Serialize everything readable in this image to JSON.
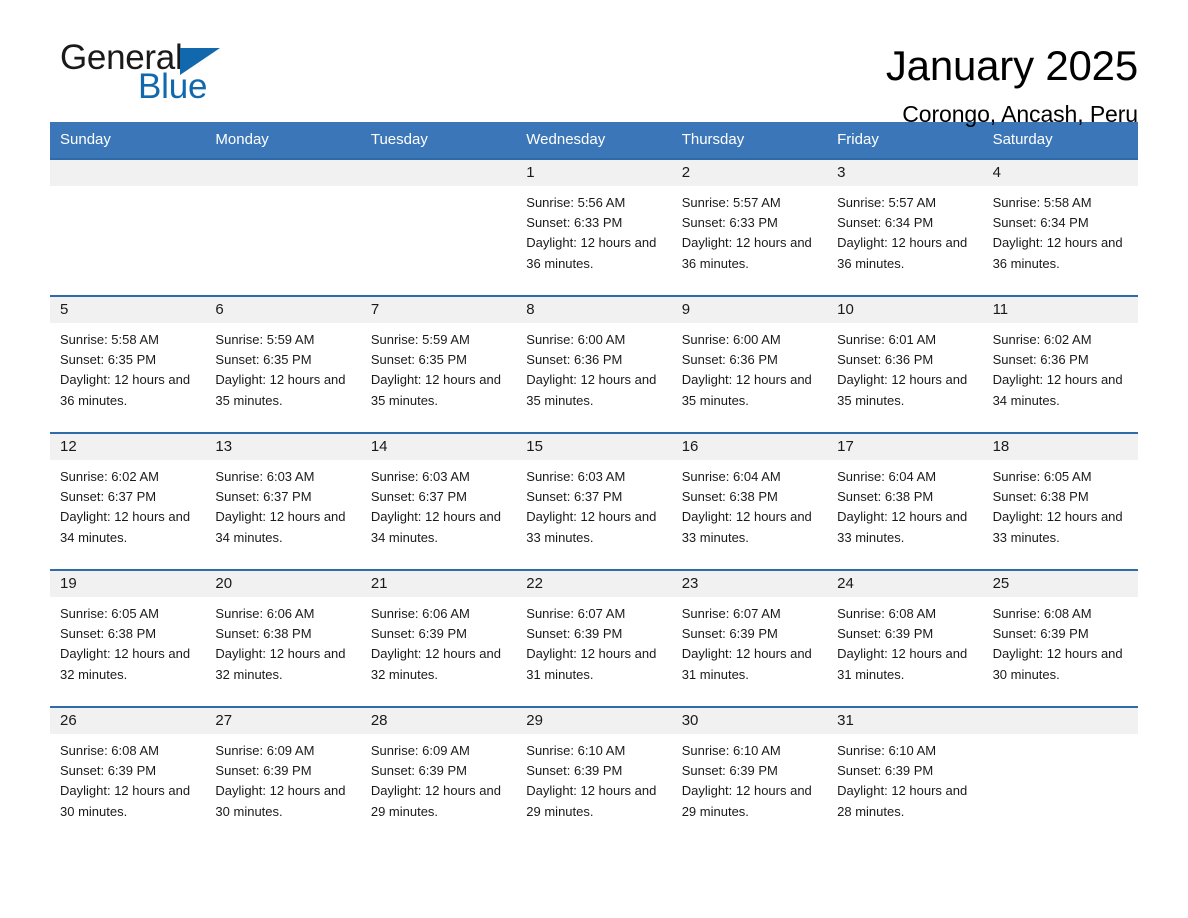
{
  "logo": {
    "word1": "General",
    "word2": "Blue",
    "triangle_color": "#1168ad"
  },
  "header": {
    "month_title": "January 2025",
    "location": "Corongo, Ancash, Peru"
  },
  "calendar": {
    "header_bg": "#3a76b8",
    "row_border": "#2d6ca8",
    "daynum_bg": "#f1f1f1",
    "weekdays": [
      "Sunday",
      "Monday",
      "Tuesday",
      "Wednesday",
      "Thursday",
      "Friday",
      "Saturday"
    ],
    "weeks": [
      [
        {
          "day": ""
        },
        {
          "day": ""
        },
        {
          "day": ""
        },
        {
          "day": "1",
          "sunrise": "Sunrise: 5:56 AM",
          "sunset": "Sunset: 6:33 PM",
          "daylight": "Daylight: 12 hours and 36 minutes."
        },
        {
          "day": "2",
          "sunrise": "Sunrise: 5:57 AM",
          "sunset": "Sunset: 6:33 PM",
          "daylight": "Daylight: 12 hours and 36 minutes."
        },
        {
          "day": "3",
          "sunrise": "Sunrise: 5:57 AM",
          "sunset": "Sunset: 6:34 PM",
          "daylight": "Daylight: 12 hours and 36 minutes."
        },
        {
          "day": "4",
          "sunrise": "Sunrise: 5:58 AM",
          "sunset": "Sunset: 6:34 PM",
          "daylight": "Daylight: 12 hours and 36 minutes."
        }
      ],
      [
        {
          "day": "5",
          "sunrise": "Sunrise: 5:58 AM",
          "sunset": "Sunset: 6:35 PM",
          "daylight": "Daylight: 12 hours and 36 minutes."
        },
        {
          "day": "6",
          "sunrise": "Sunrise: 5:59 AM",
          "sunset": "Sunset: 6:35 PM",
          "daylight": "Daylight: 12 hours and 35 minutes."
        },
        {
          "day": "7",
          "sunrise": "Sunrise: 5:59 AM",
          "sunset": "Sunset: 6:35 PM",
          "daylight": "Daylight: 12 hours and 35 minutes."
        },
        {
          "day": "8",
          "sunrise": "Sunrise: 6:00 AM",
          "sunset": "Sunset: 6:36 PM",
          "daylight": "Daylight: 12 hours and 35 minutes."
        },
        {
          "day": "9",
          "sunrise": "Sunrise: 6:00 AM",
          "sunset": "Sunset: 6:36 PM",
          "daylight": "Daylight: 12 hours and 35 minutes."
        },
        {
          "day": "10",
          "sunrise": "Sunrise: 6:01 AM",
          "sunset": "Sunset: 6:36 PM",
          "daylight": "Daylight: 12 hours and 35 minutes."
        },
        {
          "day": "11",
          "sunrise": "Sunrise: 6:02 AM",
          "sunset": "Sunset: 6:36 PM",
          "daylight": "Daylight: 12 hours and 34 minutes."
        }
      ],
      [
        {
          "day": "12",
          "sunrise": "Sunrise: 6:02 AM",
          "sunset": "Sunset: 6:37 PM",
          "daylight": "Daylight: 12 hours and 34 minutes."
        },
        {
          "day": "13",
          "sunrise": "Sunrise: 6:03 AM",
          "sunset": "Sunset: 6:37 PM",
          "daylight": "Daylight: 12 hours and 34 minutes."
        },
        {
          "day": "14",
          "sunrise": "Sunrise: 6:03 AM",
          "sunset": "Sunset: 6:37 PM",
          "daylight": "Daylight: 12 hours and 34 minutes."
        },
        {
          "day": "15",
          "sunrise": "Sunrise: 6:03 AM",
          "sunset": "Sunset: 6:37 PM",
          "daylight": "Daylight: 12 hours and 33 minutes."
        },
        {
          "day": "16",
          "sunrise": "Sunrise: 6:04 AM",
          "sunset": "Sunset: 6:38 PM",
          "daylight": "Daylight: 12 hours and 33 minutes."
        },
        {
          "day": "17",
          "sunrise": "Sunrise: 6:04 AM",
          "sunset": "Sunset: 6:38 PM",
          "daylight": "Daylight: 12 hours and 33 minutes."
        },
        {
          "day": "18",
          "sunrise": "Sunrise: 6:05 AM",
          "sunset": "Sunset: 6:38 PM",
          "daylight": "Daylight: 12 hours and 33 minutes."
        }
      ],
      [
        {
          "day": "19",
          "sunrise": "Sunrise: 6:05 AM",
          "sunset": "Sunset: 6:38 PM",
          "daylight": "Daylight: 12 hours and 32 minutes."
        },
        {
          "day": "20",
          "sunrise": "Sunrise: 6:06 AM",
          "sunset": "Sunset: 6:38 PM",
          "daylight": "Daylight: 12 hours and 32 minutes."
        },
        {
          "day": "21",
          "sunrise": "Sunrise: 6:06 AM",
          "sunset": "Sunset: 6:39 PM",
          "daylight": "Daylight: 12 hours and 32 minutes."
        },
        {
          "day": "22",
          "sunrise": "Sunrise: 6:07 AM",
          "sunset": "Sunset: 6:39 PM",
          "daylight": "Daylight: 12 hours and 31 minutes."
        },
        {
          "day": "23",
          "sunrise": "Sunrise: 6:07 AM",
          "sunset": "Sunset: 6:39 PM",
          "daylight": "Daylight: 12 hours and 31 minutes."
        },
        {
          "day": "24",
          "sunrise": "Sunrise: 6:08 AM",
          "sunset": "Sunset: 6:39 PM",
          "daylight": "Daylight: 12 hours and 31 minutes."
        },
        {
          "day": "25",
          "sunrise": "Sunrise: 6:08 AM",
          "sunset": "Sunset: 6:39 PM",
          "daylight": "Daylight: 12 hours and 30 minutes."
        }
      ],
      [
        {
          "day": "26",
          "sunrise": "Sunrise: 6:08 AM",
          "sunset": "Sunset: 6:39 PM",
          "daylight": "Daylight: 12 hours and 30 minutes."
        },
        {
          "day": "27",
          "sunrise": "Sunrise: 6:09 AM",
          "sunset": "Sunset: 6:39 PM",
          "daylight": "Daylight: 12 hours and 30 minutes."
        },
        {
          "day": "28",
          "sunrise": "Sunrise: 6:09 AM",
          "sunset": "Sunset: 6:39 PM",
          "daylight": "Daylight: 12 hours and 29 minutes."
        },
        {
          "day": "29",
          "sunrise": "Sunrise: 6:10 AM",
          "sunset": "Sunset: 6:39 PM",
          "daylight": "Daylight: 12 hours and 29 minutes."
        },
        {
          "day": "30",
          "sunrise": "Sunrise: 6:10 AM",
          "sunset": "Sunset: 6:39 PM",
          "daylight": "Daylight: 12 hours and 29 minutes."
        },
        {
          "day": "31",
          "sunrise": "Sunrise: 6:10 AM",
          "sunset": "Sunset: 6:39 PM",
          "daylight": "Daylight: 12 hours and 28 minutes."
        },
        {
          "day": ""
        }
      ]
    ]
  }
}
